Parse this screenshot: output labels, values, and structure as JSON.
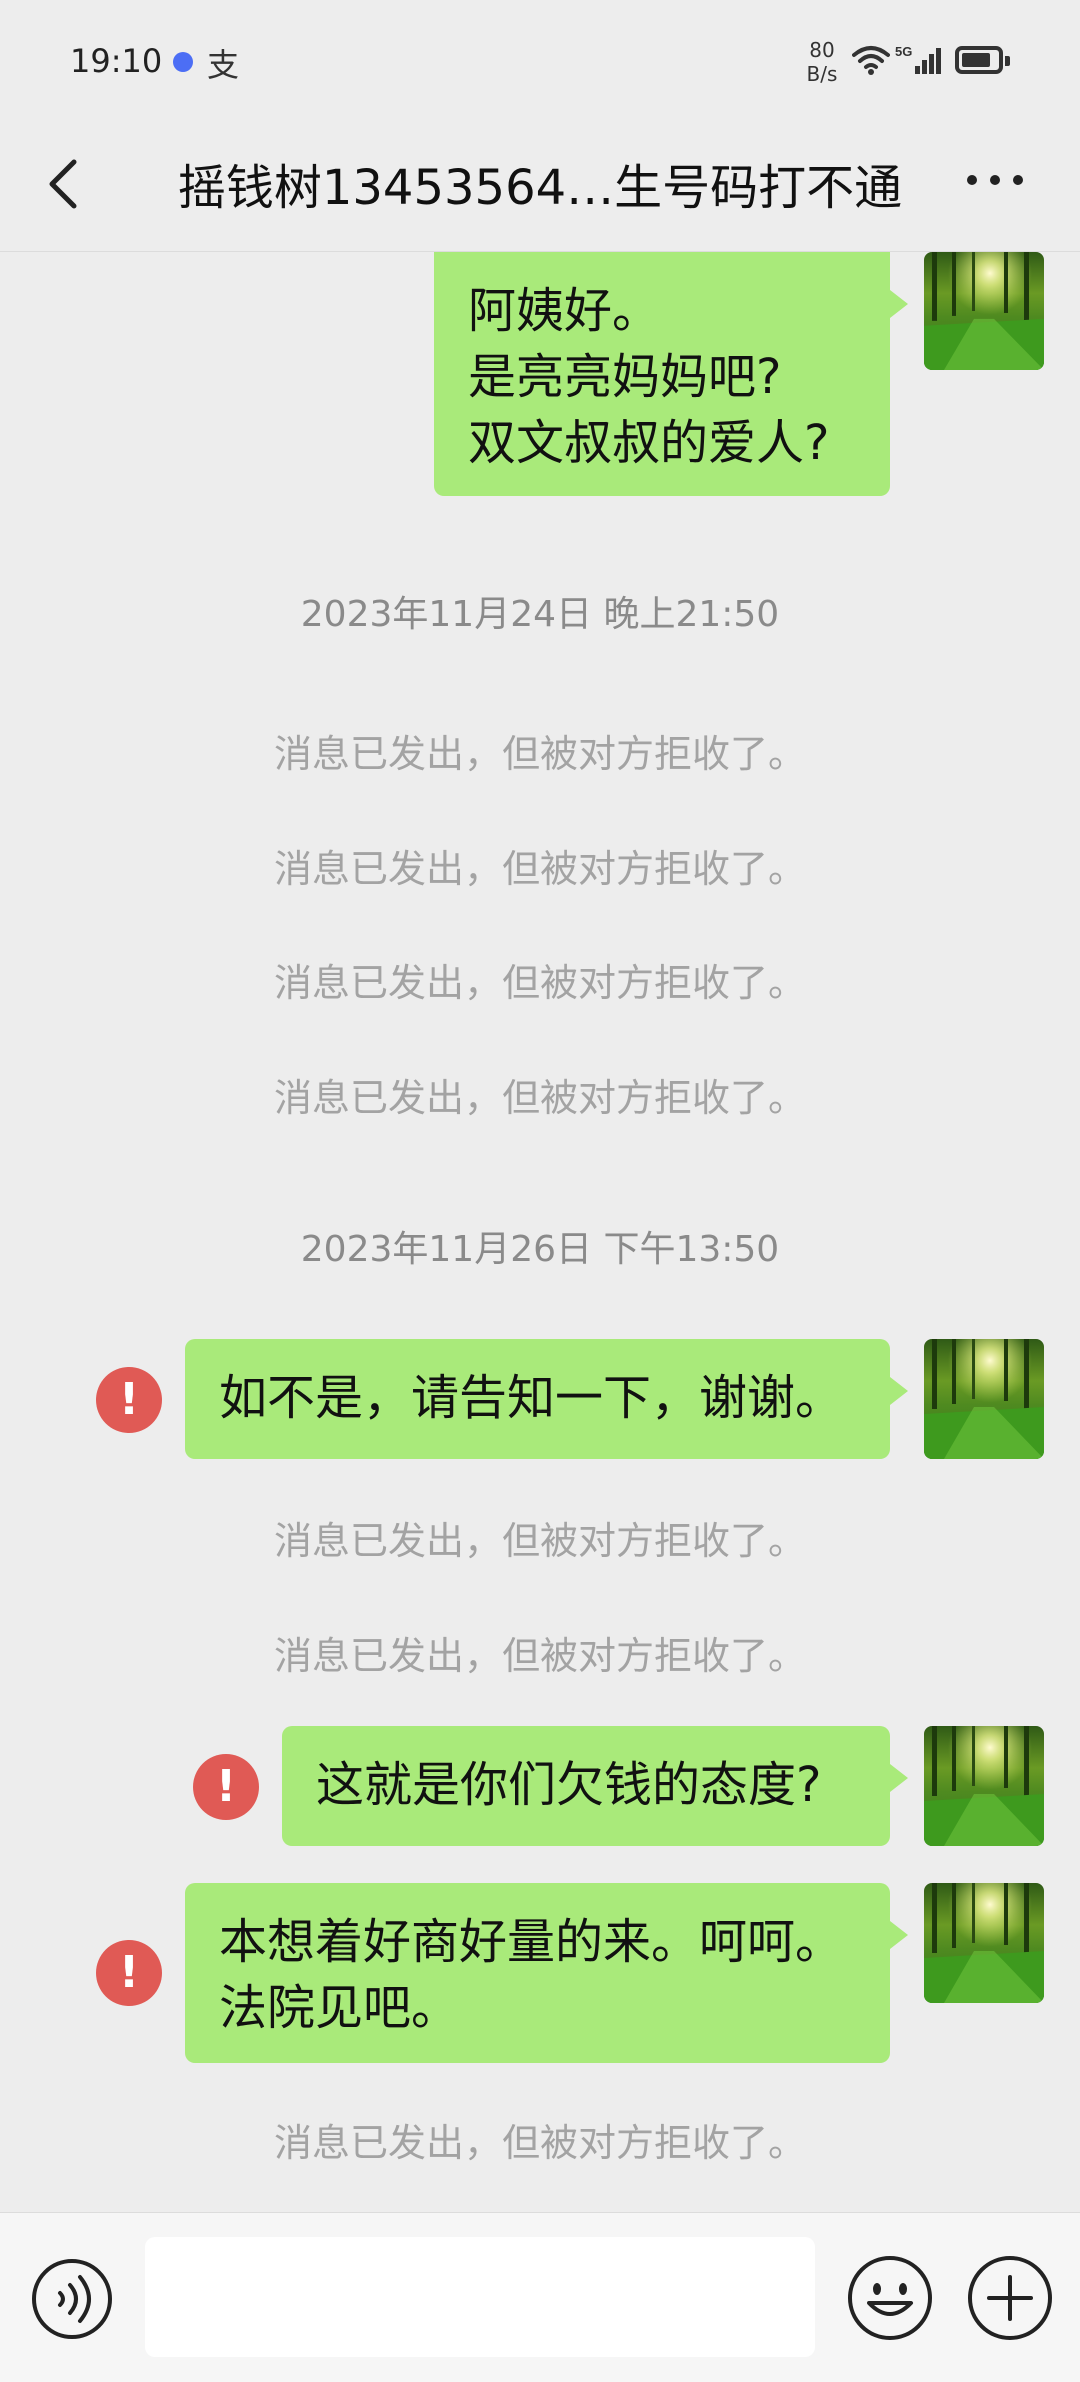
{
  "status_bar": {
    "time": "19:10",
    "app_glyph": "支",
    "net_speed_value": "80",
    "net_speed_unit": "B/s",
    "signal_label": "5G",
    "icons": [
      "blue-dot-icon",
      "alipay-icon",
      "wifi-icon",
      "signal-5g-icon",
      "battery-icon"
    ]
  },
  "header": {
    "back_icon": "chevron-left-icon",
    "title": "摇钱树13453564…生号码打不通",
    "more_icon": "more-dots-icon"
  },
  "chat": {
    "message_1": {
      "text": "阿姨好。\n是亮亮妈妈吧?\n双文叔叔的爱人?"
    },
    "timestamp_1": "2023年11月24日 晚上21:50",
    "rejected_notice": "消息已发出，但被对方拒收了。",
    "timestamp_2": "2023年11月26日 下午13:50",
    "message_2": {
      "text": "如不是，请告知一下，谢谢。",
      "failed": true
    },
    "message_3": {
      "text": "这就是你们欠钱的态度?",
      "failed": true
    },
    "message_4": {
      "text": "本想着好商好量的来。呵呵。\n法院见吧。",
      "failed": true
    },
    "failed_glyph": "!"
  },
  "input_bar": {
    "voice_icon": "voice-icon",
    "input_value": "",
    "emoji_icon": "emoji-icon",
    "plus_icon": "plus-icon"
  },
  "colors": {
    "background": "#ededed",
    "bubble": "#a9ea7a",
    "error": "#e05a55"
  }
}
